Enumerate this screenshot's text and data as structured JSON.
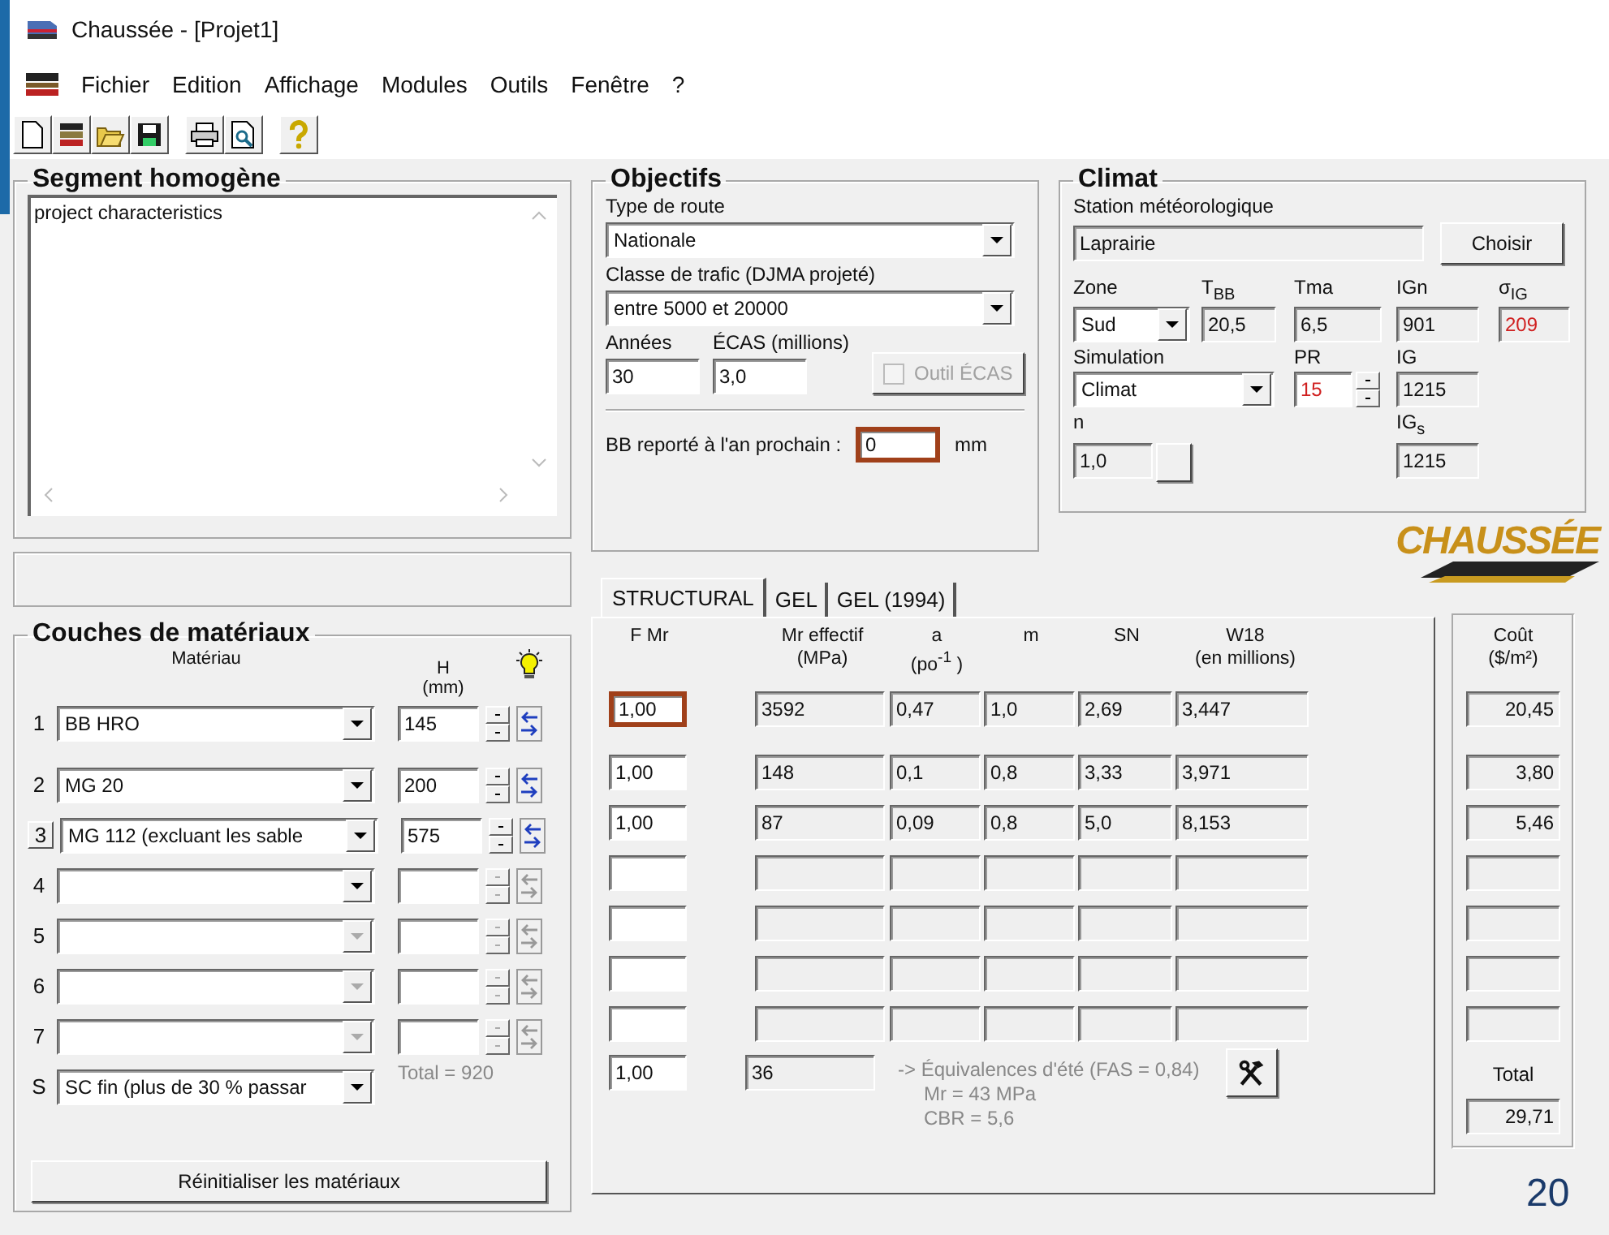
{
  "window": {
    "title": "Chaussée - [Projet1]"
  },
  "menu": [
    "Fichier",
    "Edition",
    "Affichage",
    "Modules",
    "Outils",
    "Fenêtre",
    "?"
  ],
  "segment": {
    "title": "Segment homogène",
    "text": "project characteristics"
  },
  "objectifs": {
    "title": "Objectifs",
    "road_type_label": "Type de route",
    "road_type": "Nationale",
    "traffic_label": "Classe de trafic (DJMA projeté)",
    "traffic": "entre 5000 et 20000",
    "years_label": "Années",
    "years": "30",
    "ecas_label": "ÉCAS (millions)",
    "ecas": "3,0",
    "ecas_tool": {
      "label": "Outil ÉCAS",
      "checked": false,
      "disabled": true
    },
    "bb_label": "BB reporté à l'an prochain :",
    "bb_value": "0",
    "bb_unit": "mm",
    "bb_highlighted": true
  },
  "climat": {
    "title": "Climat",
    "station_label": "Station météorologique",
    "station": "Laprairie",
    "choose_button": "Choisir",
    "zone_label": "Zone",
    "zone": "Sud",
    "tbb_label": "T$_{BB}$",
    "tbb": "20,5",
    "tma_label": "Tma",
    "tma": "6,5",
    "ign_label": "IGn",
    "ign": "901",
    "sigma_label": "σ$_{IG}$",
    "sigma": "209",
    "sigma_warning": true,
    "simulation_label": "Simulation",
    "simulation": "Climat",
    "pr_label": "PR",
    "pr": "15",
    "pr_warning": true,
    "ig_label": "IG",
    "ig": "1215",
    "n_label": "n",
    "n": "1,0",
    "igs_label": "IG$_{s}$",
    "igs": "1215"
  },
  "logo": "CHAUSSÉE",
  "materials": {
    "title": "Couches de matériaux",
    "material_header": "Matériau",
    "h_header": "H",
    "h_unit": "(mm)",
    "total": "Total = 920",
    "reset_button": "Réinitialiser les matériaux"
  },
  "tabs": [
    {
      "label": "STRUCTURAL",
      "selected": true
    },
    {
      "label": "GEL",
      "selected": false
    },
    {
      "label": "GEL (1994)",
      "selected": false
    }
  ],
  "columns": [
    {
      "title": "F Mr"
    },
    {
      "title": "Mr effectif",
      "unit": "(MPa)"
    },
    {
      "title": "a",
      "unit": "(po$^{-1}$ )"
    },
    {
      "title": "m"
    },
    {
      "title": "SN"
    },
    {
      "title": "W18",
      "unit": "(en millions)"
    }
  ],
  "layers": [
    {
      "index": "1",
      "selected": false,
      "material": "BB HRO",
      "material_enabled": true,
      "h": "145",
      "height_enabled": true,
      "values": [
        "1,00",
        "3592",
        "0,47",
        "1,0",
        "2,69",
        "3,447"
      ],
      "highlighted": true,
      "cost": "20,45"
    },
    {
      "index": "2",
      "selected": false,
      "material": "MG  20",
      "material_enabled": true,
      "h": "200",
      "height_enabled": true,
      "values": [
        "1,00",
        "148",
        "0,1",
        "0,8",
        "3,33",
        "3,971"
      ],
      "highlighted": false,
      "cost": "3,80"
    },
    {
      "index": "3",
      "selected": true,
      "material": "MG 112 (excluant les sable",
      "material_enabled": true,
      "h": "575",
      "height_enabled": true,
      "values": [
        "1,00",
        "87",
        "0,09",
        "0,8",
        "5,0",
        "8,153"
      ],
      "highlighted": false,
      "cost": "5,46"
    },
    {
      "index": "4",
      "selected": false,
      "material_enabled": true,
      "height_enabled": false,
      "highlighted": false
    },
    {
      "index": "5",
      "selected": false,
      "material_enabled": false,
      "height_enabled": false,
      "highlighted": false
    },
    {
      "index": "6",
      "selected": false,
      "material_enabled": false,
      "height_enabled": false,
      "highlighted": false
    },
    {
      "index": "7",
      "selected": false,
      "material_enabled": false,
      "height_enabled": false,
      "highlighted": false
    }
  ],
  "subgrade": {
    "index": "S",
    "material": "SC fin (plus de 30 % passar",
    "fmr": "1,00",
    "mr": "36",
    "notes": [
      "-> Équivalences d'été (FAS = 0,84)",
      "Mr = 43 MPa",
      "CBR = 5,6"
    ]
  },
  "cost": {
    "title": "Coût",
    "unit": "($/m²)",
    "total_label": "Total",
    "total": "29,71"
  },
  "page_number": "20"
}
